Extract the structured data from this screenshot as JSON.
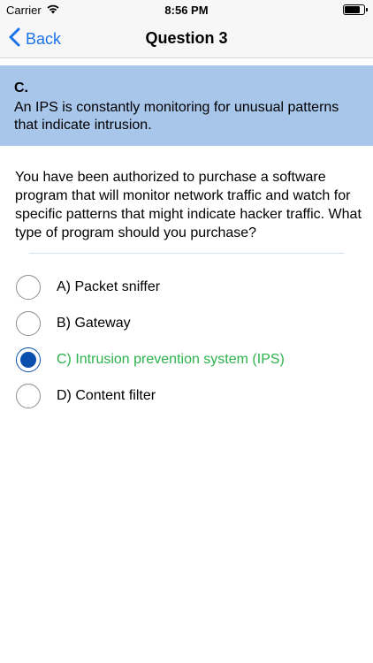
{
  "status_bar": {
    "carrier": "Carrier",
    "time": "8:56 PM",
    "wifi_icon": "wifi-icon",
    "battery_icon": "battery-icon"
  },
  "nav": {
    "back_label": "Back",
    "title": "Question 3",
    "back_icon": "chevron-left-icon"
  },
  "answer": {
    "letter": "C.",
    "explanation": "An IPS is constantly monitoring for unusual patterns that indicate intrusion."
  },
  "question": {
    "text": "You have been authorized to purchase a software program that will monitor network traffic and watch for specific patterns that might indicate hacker traffic. What type of program should you purchase?"
  },
  "options": [
    {
      "label": "A) Packet sniffer",
      "selected": false,
      "correct": false
    },
    {
      "label": "B) Gateway",
      "selected": false,
      "correct": false
    },
    {
      "label": "C) Intrusion prevention system (IPS)",
      "selected": true,
      "correct": true
    },
    {
      "label": "D) Content filter",
      "selected": false,
      "correct": false
    }
  ],
  "colors": {
    "accent": "#1a73e8",
    "banner": "#a8c5ea",
    "correct": "#2bb24c",
    "radio_selected": "#0a4fae"
  }
}
